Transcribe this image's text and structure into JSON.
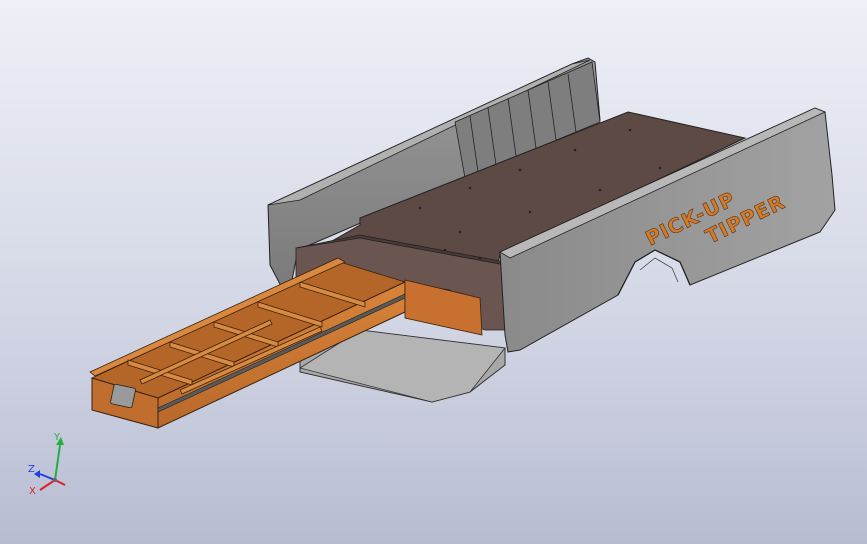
{
  "viewport": {
    "decal_line1": "PICK-UP",
    "decal_line2": "TIPPER"
  },
  "triad": {
    "x_label": "X",
    "y_label": "Y",
    "z_label": "Z",
    "x_color": "#e02020",
    "y_color": "#20b040",
    "z_color": "#2040e0"
  },
  "colors": {
    "body_gray": "#8e8e8e",
    "deck_brown": "#5e4a44",
    "drawer_orange": "#c8742c"
  }
}
